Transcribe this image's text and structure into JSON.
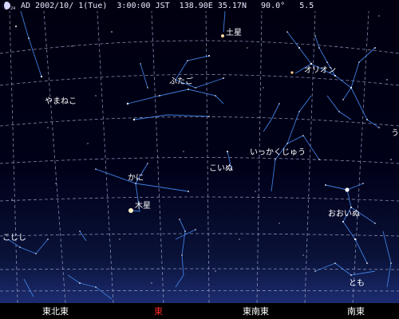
{
  "status": {
    "moon_icon": "moon-phase-icon",
    "text": "AD 2002/10/ 1(Tue)  3:00:00 JST  138.90E 35.17N   90.0°   5.5"
  },
  "planets": {
    "saturn": "土星",
    "jupiter": "木星"
  },
  "constellations": {
    "orion": "オリオン",
    "gemini": "ふたご",
    "lynx": "やまねこ",
    "monoceros": "いっかくじゅう",
    "canis_minor": "こいぬ",
    "cancer": "かに",
    "canis_major": "おおいぬ",
    "leo_minor": "こじし",
    "puppis": "とも",
    "lepus_partial": "う"
  },
  "compass": {
    "ene": "東北東",
    "e": "東",
    "ese": "東南東",
    "se": "南東"
  },
  "colors": {
    "sky_top": "#000010",
    "sky_bottom": "#1a2868",
    "grid": "#9aa2c8",
    "constellation_line": "#3f7fe0",
    "compass_highlight": "#ff2a2a"
  }
}
